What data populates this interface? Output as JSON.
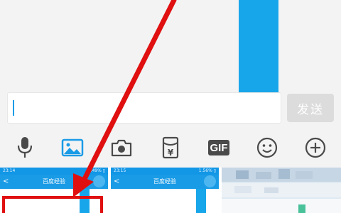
{
  "input": {
    "value": "",
    "placeholder": ""
  },
  "send_button": {
    "label": "发送"
  },
  "toolbar": {
    "items": [
      {
        "icon": "microphone-icon"
      },
      {
        "icon": "image-icon",
        "active": true
      },
      {
        "icon": "camera-icon"
      },
      {
        "icon": "red-packet-icon",
        "glyph": "¥"
      },
      {
        "icon": "gif-icon",
        "label": "GIF"
      },
      {
        "icon": "emoji-icon"
      },
      {
        "icon": "plus-icon"
      }
    ]
  },
  "thumbnails": [
    {
      "time": "23:14",
      "battery": "1.49% ▯",
      "title": "百度经验",
      "back": "<"
    },
    {
      "time": "23:15",
      "battery": "1.56% ▯",
      "title": "百度经验",
      "back": "<"
    }
  ],
  "colors": {
    "accent": "#1a9be6",
    "annotation_red": "#e01010",
    "send_disabled": "#dcdcdc"
  }
}
